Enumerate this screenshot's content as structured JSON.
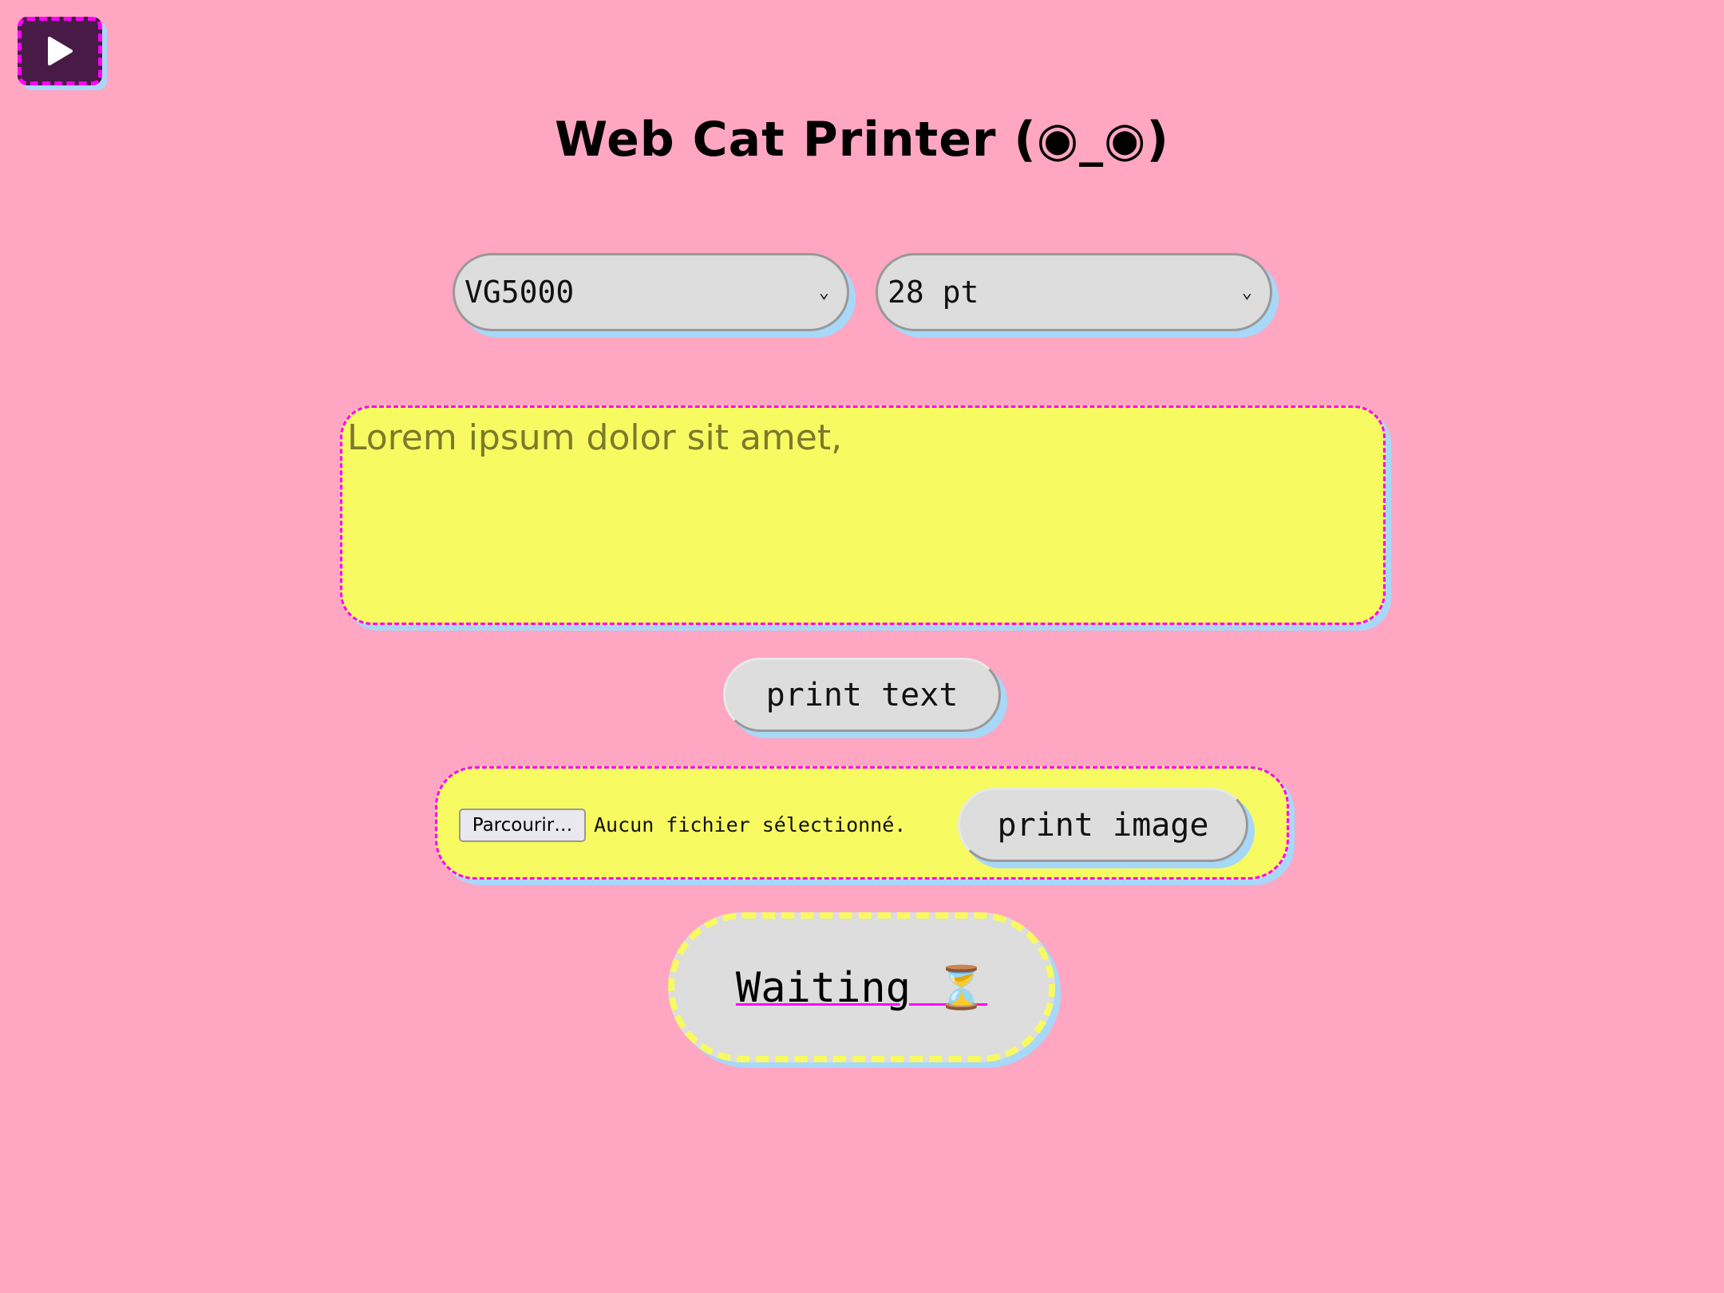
{
  "app": {
    "title": "Web Cat Printer (◉_◉)",
    "play_icon": "play-icon"
  },
  "controls": {
    "font_select": {
      "value": "VG5000"
    },
    "size_select": {
      "value": "28 pt"
    }
  },
  "text_input": {
    "value": "Lorem ipsum dolor sit amet,"
  },
  "buttons": {
    "print_text": "print text",
    "print_image": "print image"
  },
  "file_input": {
    "browse_label": "Parcourir…",
    "status": "Aucun fichier sélectionné."
  },
  "status": {
    "text": "Waiting ",
    "icon": "⏳"
  },
  "colors": {
    "background": "#ffa6c3",
    "accent": "#ff00ff",
    "panel": "#f8fa62",
    "shadow": "#a8d8f8",
    "play_button": "#481a46"
  }
}
